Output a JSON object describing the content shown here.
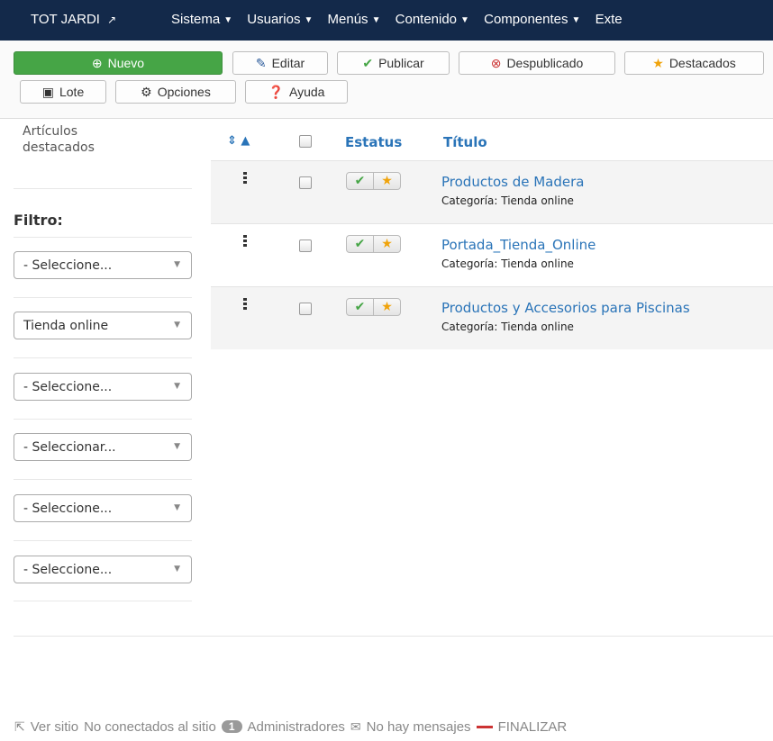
{
  "topnav": {
    "site_title": "TOT JARDI",
    "menus": [
      "Sistema",
      "Usuarios",
      "Menús",
      "Contenido",
      "Componentes",
      "Exte"
    ]
  },
  "toolbar": {
    "new_label": "Nuevo",
    "edit_label": "Editar",
    "publish_label": "Publicar",
    "unpublish_label": "Despublicado",
    "featured_label": "Destacados",
    "batch_label": "Lote",
    "options_label": "Opciones",
    "help_label": "Ayuda"
  },
  "sidebar": {
    "featured_articles": "Artículos destacados",
    "filter_label": "Filtro:",
    "selects": [
      "- Seleccione...",
      "Tienda online",
      "- Seleccione...",
      "- Seleccionar...",
      "- Seleccione...",
      "- Seleccione..."
    ]
  },
  "table": {
    "sort_icons": "⇕ ▲",
    "headers": {
      "status": "Estatus",
      "title": "Título"
    },
    "rows": [
      {
        "title": "Productos de Madera",
        "category": "Categoría: Tienda online"
      },
      {
        "title": "Portada_Tienda_Online",
        "category": "Categoría: Tienda online"
      },
      {
        "title": "Productos y Accesorios para Piscinas",
        "category": "Categoría: Tienda online"
      }
    ]
  },
  "footer": {
    "view_site": "Ver sitio",
    "not_connected": "No conectados al sitio",
    "admin_count": "1",
    "admins": "Administradores",
    "no_messages": "No hay mensajes",
    "logout": "FINALIZAR"
  },
  "colors": {
    "nav_bg": "#13294a",
    "link": "#2a74b8",
    "success": "#46a546",
    "star": "#f0a30a"
  }
}
